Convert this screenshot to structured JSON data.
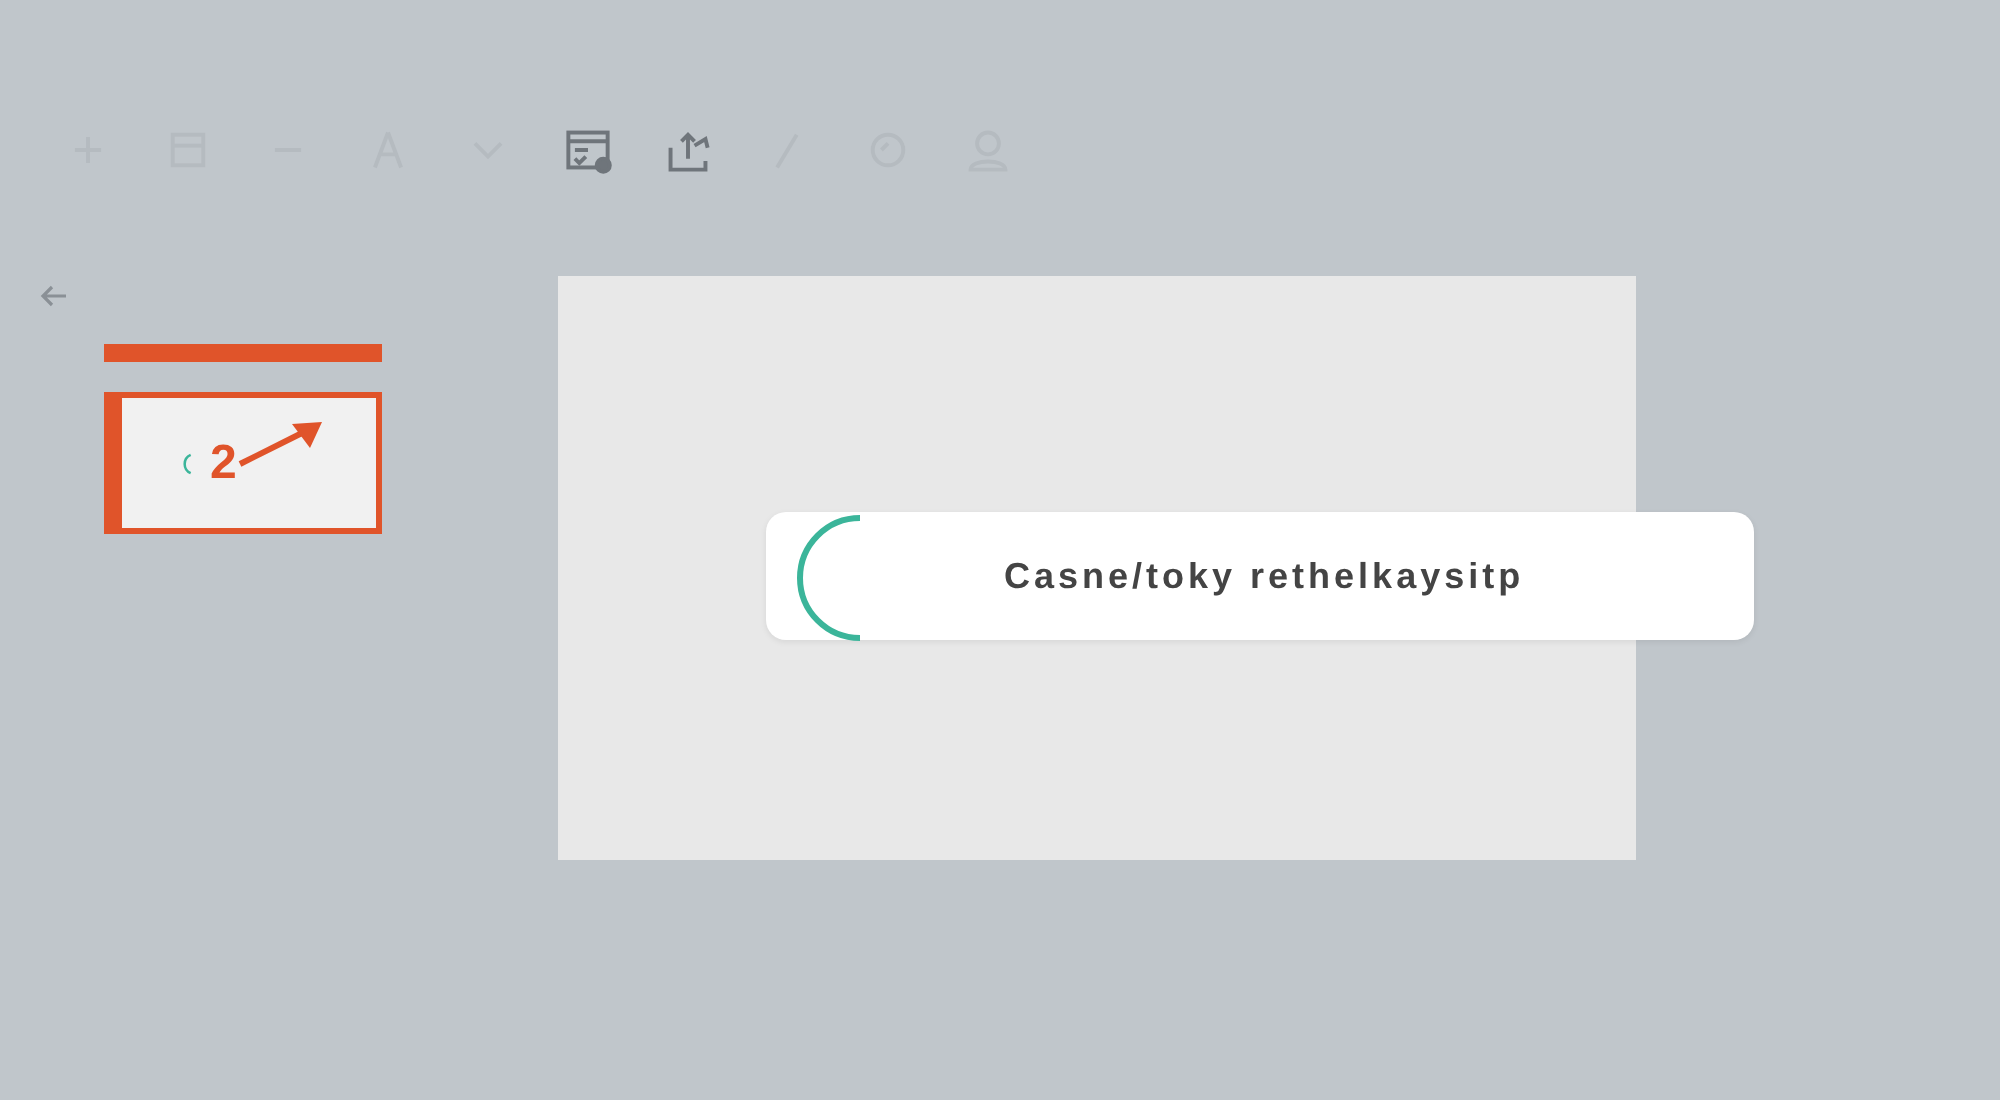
{
  "toolbar": [
    {
      "kind": "plus",
      "disabled": true
    },
    {
      "kind": "square",
      "disabled": true
    },
    {
      "kind": "minus",
      "disabled": true
    },
    {
      "kind": "figure",
      "disabled": true
    },
    {
      "kind": "chevron",
      "disabled": true
    },
    {
      "kind": "form",
      "disabled": false
    },
    {
      "kind": "share",
      "disabled": false
    },
    {
      "kind": "pen",
      "disabled": true
    },
    {
      "kind": "circle",
      "disabled": true
    },
    {
      "kind": "user",
      "disabled": true
    }
  ],
  "slides": [
    {
      "number": "2",
      "selected": true
    }
  ],
  "toast": {
    "message": "Casne/toky rethelkaysitp"
  }
}
